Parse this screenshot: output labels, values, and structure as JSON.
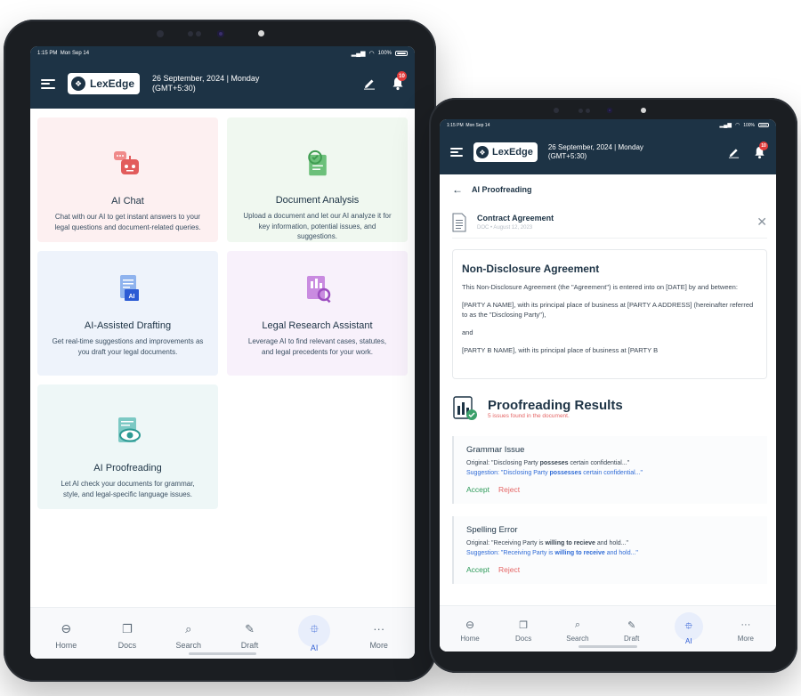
{
  "colors": {
    "header_bg": "#1d3345",
    "accent_blue": "#2c5bd4",
    "badge_red": "#e23b3b",
    "accept_green": "#2e9b5a",
    "reject_red": "#e46464",
    "card_pink": "#fdf0f1",
    "card_green": "#f0f8f0",
    "card_blue": "#eef3fb",
    "card_purple": "#f8f1fb",
    "card_teal": "#eef7f7"
  },
  "status_bar": {
    "time": "1:15 PM",
    "day": "Mon Sep 14",
    "battery": "100%"
  },
  "header": {
    "logo_text": "LexEdge",
    "date_line": "26 September, 2024  |  Monday",
    "timezone": "(GMT+5:30)",
    "notification_count": "10",
    "edit_icon": "pencil-icon",
    "bell_icon": "bell-icon"
  },
  "left_tablet": {
    "cards": [
      {
        "title": "AI Chat",
        "desc": "Chat with our AI to get instant answers to your legal questions and document-related queries.",
        "icon": "chat-bot-icon"
      },
      {
        "title": "Document Analysis",
        "desc": "Upload a document and let our AI analyze it for key information, potential issues, and suggestions.",
        "icon": "document-analysis-icon"
      },
      {
        "title": "AI-Assisted Drafting",
        "desc": "Get real-time suggestions and improvements as you draft your legal documents.",
        "icon": "ai-document-icon"
      },
      {
        "title": "Legal Research Assistant",
        "desc": "Leverage AI to find relevant cases, statutes, and legal precedents for your work.",
        "icon": "research-icon"
      },
      {
        "title": "AI Proofreading",
        "desc": "Let AI check your documents for grammar, style, and legal-specific language issues.",
        "icon": "proofread-eye-icon"
      }
    ]
  },
  "nav": {
    "items": [
      {
        "label": "Home",
        "icon": "home-icon"
      },
      {
        "label": "Docs",
        "icon": "docs-icon"
      },
      {
        "label": "Search",
        "icon": "search-icon"
      },
      {
        "label": "Draft",
        "icon": "draft-icon"
      },
      {
        "label": "AI",
        "icon": "ai-chip-icon"
      },
      {
        "label": "More",
        "icon": "more-icon"
      }
    ],
    "active": "AI"
  },
  "right_tablet": {
    "page_title": "AI Proofreading",
    "document": {
      "name": "Contract Agreement",
      "meta": "DOC • August 12, 2023"
    },
    "preview": {
      "heading": "Non-Disclosure Agreement",
      "p1": "This Non-Disclosure Agreement (the \"Agreement\") is entered into on [DATE] by and between:",
      "p2": "[PARTY A NAME], with its principal place of business at [PARTY A ADDRESS] (hereinafter referred to as the \"Disclosing Party\"),",
      "p3": "and",
      "p4": "[PARTY B NAME], with its principal place of business at [PARTY B"
    },
    "results": {
      "title": "Proofreading Results",
      "summary": "5 issues found in the document.",
      "issues": [
        {
          "type": "Grammar Issue",
          "original_prefix": "Original: \"Disclosing Party ",
          "original_bold": "posseses",
          "original_suffix": " certain confidential...\"",
          "suggestion_prefix": "Suggestion: \"Disclosing Party ",
          "suggestion_bold": "possesses",
          "suggestion_suffix": " certain confidential...\"",
          "accept": "Accept",
          "reject": "Reject"
        },
        {
          "type": "Spelling Error",
          "original_prefix": "Original: \"Receiving Party is ",
          "original_bold": "willing to recieve",
          "original_suffix": " and hold...\"",
          "suggestion_prefix": "Suggestion: \"Receiving Party is ",
          "suggestion_bold": "willing to receive",
          "suggestion_suffix": " and hold...\"",
          "accept": "Accept",
          "reject": "Reject"
        }
      ]
    }
  }
}
